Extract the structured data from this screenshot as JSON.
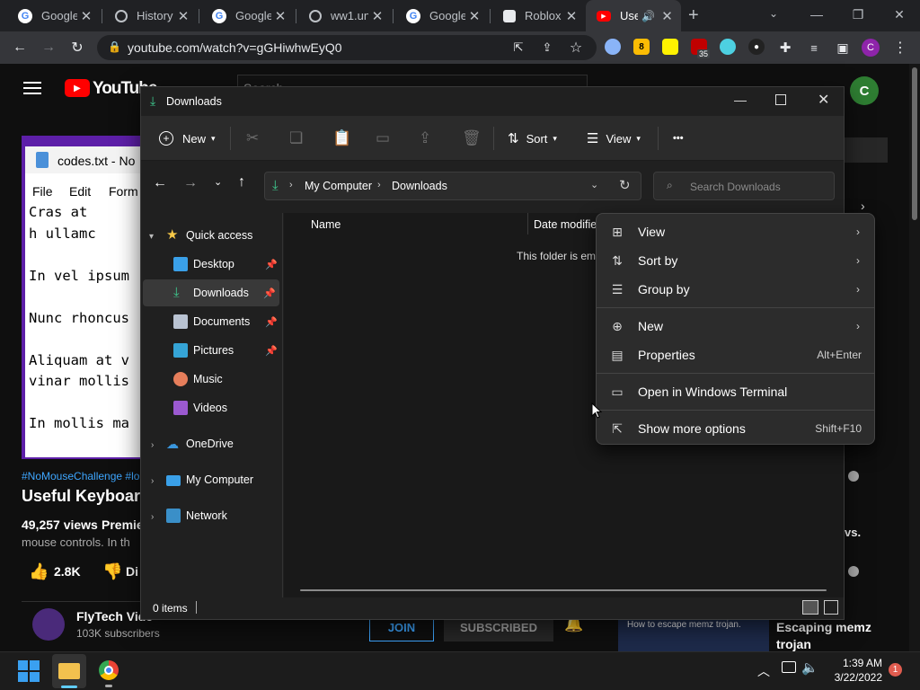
{
  "chrome": {
    "tabs": [
      {
        "title": "Google"
      },
      {
        "title": "History"
      },
      {
        "title": "Google"
      },
      {
        "title": "ww1.un"
      },
      {
        "title": "Google"
      },
      {
        "title": "Roblox"
      },
      {
        "title": "Use"
      }
    ],
    "new_tab": "+",
    "url": "youtube.com/watch?v=gGHiwhwEyQ0",
    "ext_badge": "35",
    "profile_letter": "C"
  },
  "youtube": {
    "logo": "YouTube",
    "search_placeholder": "Search",
    "avatar_letter": "C",
    "notepad": {
      "title": "codes.txt - No",
      "menu": [
        "File",
        "Edit",
        "Form"
      ],
      "lines": [
        "Cras at",
        "h ullamc",
        "",
        "In vel ipsum",
        "",
        "Nunc rhoncus",
        "",
        "Aliquam at v",
        "vinar mollis",
        "",
        "In mollis ma"
      ]
    },
    "hashtags": "#NoMouseChallenge #lo",
    "video_title": "Useful Keyboar",
    "views": "49,257 views",
    "premiered": "Premie",
    "desc": "mouse controls. In th",
    "likes": "2.8K",
    "dislike": "Di",
    "channel": "FlyTech Vide",
    "subs": "103K subscribers",
    "join": "JOIN",
    "subscribed": "SUBSCRIBED",
    "side_vs": "vs.",
    "thumb_caption": "How to escape memz trojan.",
    "side_title_1": "Escaping memz",
    "side_title_2": "trojan"
  },
  "explorer": {
    "title": "Downloads",
    "cmd": {
      "new": "New",
      "sort": "Sort",
      "view": "View",
      "more": "•••"
    },
    "breadcrumb": [
      "My Computer",
      "Downloads"
    ],
    "search_placeholder": "Search Downloads",
    "nav": {
      "quick_access": "Quick access",
      "desktop": "Desktop",
      "downloads": "Downloads",
      "documents": "Documents",
      "pictures": "Pictures",
      "music": "Music",
      "videos": "Videos",
      "onedrive": "OneDrive",
      "my_computer": "My Computer",
      "network": "Network"
    },
    "columns": {
      "name": "Name",
      "date": "Date modifie"
    },
    "empty_text": "This folder is em",
    "status_items": "0 items"
  },
  "context_menu": {
    "view": "View",
    "sort_by": "Sort by",
    "group_by": "Group by",
    "new": "New",
    "properties": "Properties",
    "properties_shortcut": "Alt+Enter",
    "terminal": "Open in Windows Terminal",
    "more_options": "Show more options",
    "more_options_shortcut": "Shift+F10"
  },
  "taskbar": {
    "time": "1:39 AM",
    "date": "3/22/2022",
    "notification_count": "1"
  },
  "colors": {
    "yt_red": "#ff0000",
    "chrome_tab_active": "#35363a",
    "explorer_bg": "#202020",
    "accent_green": "#2e7d32",
    "download_green": "#3ec78d"
  }
}
